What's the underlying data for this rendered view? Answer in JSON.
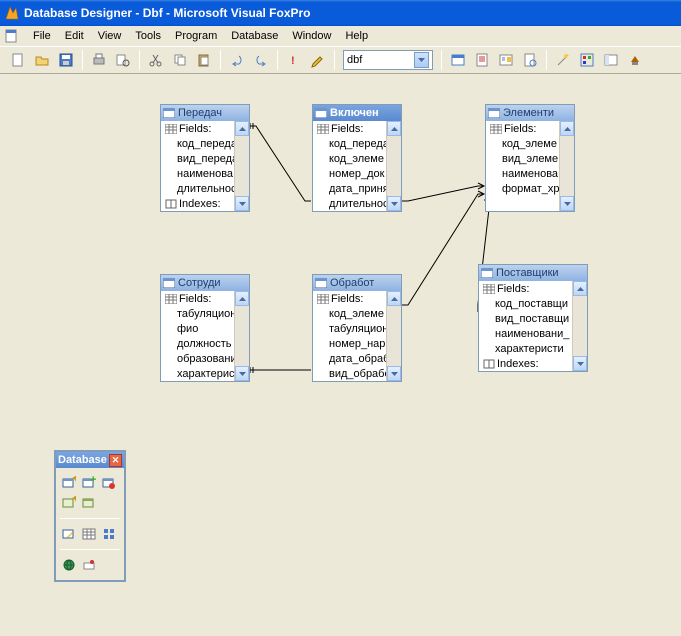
{
  "window": {
    "title": "Database Designer - Dbf - Microsoft Visual FoxPro"
  },
  "menu": {
    "file": "File",
    "edit": "Edit",
    "view": "View",
    "tools": "Tools",
    "program": "Program",
    "database": "Database",
    "window": "Window",
    "help": "Help"
  },
  "toolbar": {
    "combo_value": "dbf"
  },
  "tables": {
    "peredach": {
      "title": "Передач",
      "fields_label": "Fields:",
      "fields": [
        "код_переда",
        "вид_переда",
        "наименова",
        "длительнос"
      ],
      "indexes_label": "Indexes:"
    },
    "vklyuchen": {
      "title": "Включен",
      "fields_label": "Fields:",
      "fields": [
        "код_переда",
        "код_элеме",
        "номер_док",
        "дата_приня",
        "длительнос"
      ]
    },
    "elementi": {
      "title": "Элементи",
      "fields_label": "Fields:",
      "fields": [
        "код_элеме",
        "вид_элеме",
        "наименова",
        "формат_хр",
        ""
      ]
    },
    "sotrudi": {
      "title": "Сотруди",
      "fields_label": "Fields:",
      "fields": [
        "табуляцион",
        "фио",
        "должность",
        "образовани",
        "характерис"
      ]
    },
    "obrabot": {
      "title": "Обработ",
      "fields_label": "Fields:",
      "fields": [
        "код_элеме",
        "табуляцион",
        "номер_нар",
        "дата_обраб",
        "вид_обрабо"
      ]
    },
    "postavshiki": {
      "title": "Поставщики",
      "fields_label": "Fields:",
      "fields": [
        "код_поставщи",
        "вид_поставщи",
        "наименовани_",
        "характеристи"
      ],
      "indexes_label": "Indexes:"
    }
  },
  "palette": {
    "title": "Database"
  }
}
